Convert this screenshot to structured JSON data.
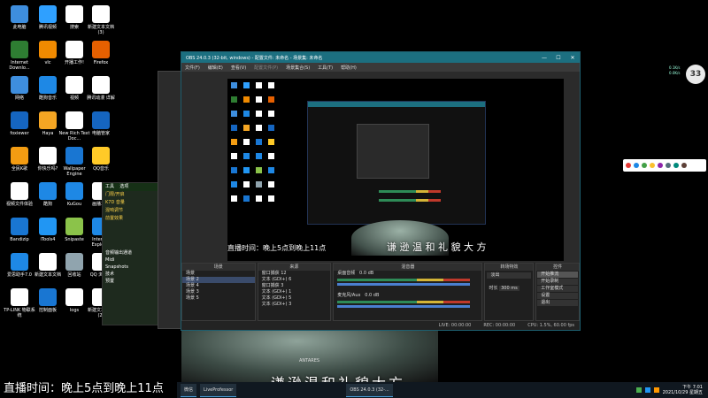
{
  "desktop_icons": [
    {
      "label": "此电脑",
      "color": "#3e8ede"
    },
    {
      "label": "腾讯视频",
      "color": "#2fa0ff"
    },
    {
      "label": "搜索",
      "color": "#ffffff"
    },
    {
      "label": "新建文本文档 (3)",
      "color": "#ffffff"
    },
    {
      "label": "Internet Downlo...",
      "color": "#2e7d32"
    },
    {
      "label": "vlc",
      "color": "#f08a00"
    },
    {
      "label": "开播工作!",
      "color": "#ffffff"
    },
    {
      "label": "Firefox",
      "color": "#e66000"
    },
    {
      "label": "网络",
      "color": "#3e8ede"
    },
    {
      "label": "酷狗音乐",
      "color": "#1e88e5"
    },
    {
      "label": "视频",
      "color": "#ffffff"
    },
    {
      "label": "腾讯动漫 详解",
      "color": "#ffffff"
    },
    {
      "label": "foxiewer",
      "color": "#1565c0"
    },
    {
      "label": "Haya",
      "color": "#f5a623"
    },
    {
      "label": "New Rich Text Doc...",
      "color": "#ffffff"
    },
    {
      "label": "电脑管家",
      "color": "#1565c0"
    },
    {
      "label": "全民K歌",
      "color": "#f39c12"
    },
    {
      "label": "你快乐吗?",
      "color": "#ffffff"
    },
    {
      "label": "Wallpaper Engine",
      "color": "#1976d2"
    },
    {
      "label": "QQ音乐",
      "color": "#ffca28"
    },
    {
      "label": "视频文件体验",
      "color": "#ffffff"
    },
    {
      "label": "酷狗",
      "color": "#1e88e5"
    },
    {
      "label": "KuGou",
      "color": "#1e88e5"
    },
    {
      "label": "画播工具",
      "color": "#ffffff"
    },
    {
      "label": "Bandizip",
      "color": "#1976d2"
    },
    {
      "label": "iTools4",
      "color": "#2196f3"
    },
    {
      "label": "Snipaste",
      "color": "#8bc34a"
    },
    {
      "label": "Internet Explorer",
      "color": "#1e88e5"
    },
    {
      "label": "爱思助手7.0",
      "color": "#1e88e5"
    },
    {
      "label": "新建文本文档",
      "color": "#ffffff"
    },
    {
      "label": "回收站",
      "color": "#90a4ae"
    },
    {
      "label": "QQ 浏览器",
      "color": "#ffffff"
    },
    {
      "label": "TP-LINK 物联系统",
      "color": "#ffffff"
    },
    {
      "label": "控制面板",
      "color": "#1976d2"
    },
    {
      "label": "logs",
      "color": "#ffffff"
    },
    {
      "label": "新建文本文档 (2)",
      "color": "#ffffff"
    }
  ],
  "obs": {
    "title": "OBS 24.0.3 (32-bit, windows) - 配置文件: 未命名 - 场景集: 未命名",
    "menu": [
      "文件(F)",
      "编辑(E)",
      "查看(V)",
      "配置文件(P)",
      "场景集合(S)",
      "工具(T)",
      "帮助(H)"
    ],
    "scenes_header": "场景",
    "scenes": [
      "场景",
      "场景 2",
      "场景 4",
      "场景 3",
      "场景 5"
    ],
    "sources_header": "来源",
    "sources": [
      "窗口捕获 12",
      "文本 (GDI+) 6",
      "窗口捕获 3",
      "文本 (GDI+) 1",
      "文本 (GDI+) 5",
      "文本 (GDI+) 3"
    ],
    "mixer_header": "混音器",
    "mixer": [
      {
        "name": "桌面音频",
        "level": "0.0 dB"
      },
      {
        "name": "麦克风/Aux",
        "level": "0.0 dB"
      }
    ],
    "transitions_header": "转场特效",
    "transition_type": "淡出",
    "duration_label": "时长",
    "duration_value": "300 ms",
    "controls_header": "控件",
    "controls": [
      "开始推流",
      "开始录制",
      "工作室模式",
      "设置",
      "退出"
    ],
    "status": [
      "LIVE: 00:00:00",
      "REC: 00:00:00",
      "CPU: 1.5%, 60.00 fps"
    ]
  },
  "left_app": {
    "header": [
      "工具",
      "选项"
    ],
    "items": [
      "门限/开启",
      "K7D 音量",
      "混响调节",
      "前置效果"
    ],
    "menu": [
      "音频输出通道",
      "Midi",
      "Snapshots",
      "技术",
      "预置"
    ]
  },
  "caption_top": "谦 逊 温 和 礼 貌 大 方",
  "caption_bottom": "谦逊温和礼貌大方",
  "caption_left": "直播时间：晚上5点到晚上11点",
  "caption_inner": "直播时间：晚上5点到晚上11点",
  "taskbar": {
    "items": [
      "微信",
      "LiveProfessor",
      "OBS 24.0.3 (32-..."
    ],
    "time": "下午 7:01",
    "date": "2021/10/29 星期五"
  },
  "widget_badge": "33",
  "widget_net": [
    "0.1K/s",
    "0.0K/s"
  ],
  "amplifier_brand": "ANTARES",
  "icons": {
    "close": "close-icon",
    "minimize": "minimize-icon",
    "maximize": "maximize-icon",
    "ime": "sogou-ime-icon"
  }
}
